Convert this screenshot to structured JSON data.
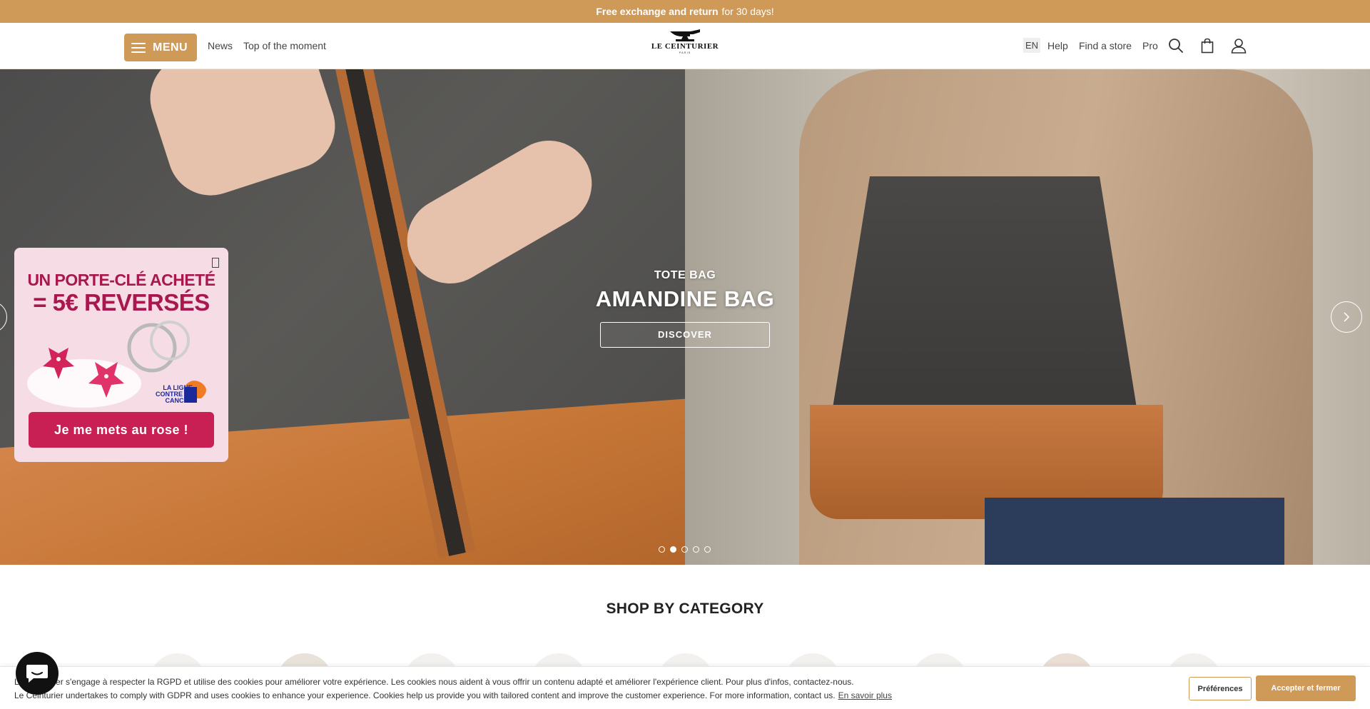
{
  "announcement": {
    "bold": "Free exchange and return",
    "rest": "for 30 days!"
  },
  "header": {
    "menu_label": "MENU",
    "nav": [
      "News",
      "Top of the moment"
    ],
    "logo_text": "LE CEINTURIER",
    "logo_sub": "PARIS",
    "lang": "EN",
    "links": [
      "Help",
      "Find a store",
      "Pro"
    ],
    "icons": [
      "search-icon",
      "bag-icon",
      "account-icon"
    ]
  },
  "hero": {
    "kicker": "TOTE BAG",
    "title": "AMANDINE BAG",
    "cta": "DISCOVER",
    "slides": 5,
    "active_slide": 2
  },
  "promo": {
    "line1": "UN PORTE-CLÉ ACHETÉ",
    "line2": "= 5€ REVERSÉS",
    "partner": "LA LIGUE CONTRE LE CANCER",
    "button": "Je me mets au rose !"
  },
  "section_title": "SHOP BY CATEGORY",
  "cookie": {
    "line1": "Le Ceinturier s'engage à respecter la RGPD et utilise des cookies pour améliorer votre expérience. Les cookies nous aident à vous offrir un contenu adapté et améliorer l'expérience client. Pour plus d'infos, contactez-nous.",
    "line2": "Le Ceinturier undertakes to comply with GDPR and uses cookies to enhance your experience. Cookies help us provide you with tailored content and improve the customer experience. For more information, contact us.",
    "link": "En savoir plus",
    "preferences": "Préférences",
    "accept": "Accepter et fermer"
  },
  "colors": {
    "accent": "#cf9a58",
    "promo_pink": "#c81f54"
  }
}
